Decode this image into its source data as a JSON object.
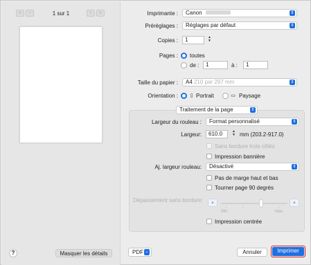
{
  "preview": {
    "page_count": "1 sur 1",
    "hide_details_label": "Masquer les détails",
    "help_label": "?"
  },
  "printer": {
    "label": "Imprimante :",
    "value": "Canon"
  },
  "presets": {
    "label": "Préréglages :",
    "value": "Réglages par défaut"
  },
  "copies": {
    "label": "Copies :",
    "value": "1"
  },
  "pages": {
    "label": "Pages :",
    "all_label": "toutes",
    "from_label": "de :",
    "from_value": "1",
    "to_label": "à :",
    "to_value": "1"
  },
  "paper_size": {
    "label": "Taille du papier :",
    "value": "A4",
    "detail": "210 par 297 mm"
  },
  "orientation": {
    "label": "Orientation :",
    "portrait_label": "Portrait",
    "landscape_label": "Paysage"
  },
  "section_select": {
    "value": "Traitement de la page"
  },
  "roll": {
    "width_label": "Largeur du rouleau :",
    "width_value": "Format personnalisé",
    "size_label": "Largeur:",
    "size_value": "610.0",
    "size_unit": "mm (203.2-917.0)",
    "borderless_sides_label": "Sans bordure trois côtés",
    "banner_label": "Impression bannière",
    "adjust_label": "Aj. largeur rouleau:",
    "adjust_value": "Désactivé",
    "no_margin_label": "Pas de marge haut et bas",
    "rotate_label": "Tourner page 90 degrés",
    "overflow_label": "Dépassement sans bordure:",
    "slider_min": "Min",
    "slider_max": "Max",
    "centered_label": "Impression centrée"
  },
  "footer": {
    "pdf_label": "PDF",
    "cancel_label": "Annuler",
    "print_label": "Imprimer"
  },
  "colors": {
    "accent": "#1f6fe0",
    "highlight_border": "#d32020"
  }
}
